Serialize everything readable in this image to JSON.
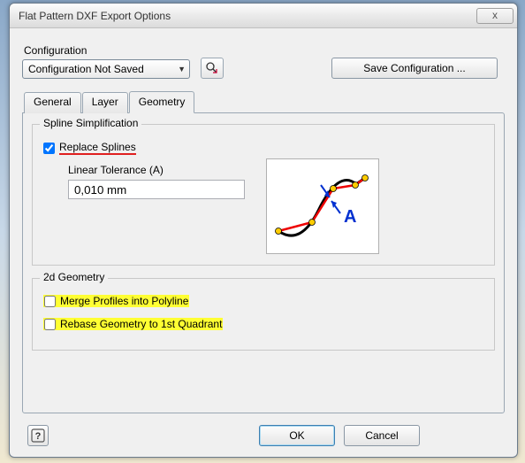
{
  "titlebar": {
    "title": "Flat Pattern DXF Export Options",
    "close_glyph": "x"
  },
  "configuration": {
    "label": "Configuration",
    "selected": "Configuration Not Saved",
    "save_btn": "Save Configuration ..."
  },
  "tabs": {
    "general": "General",
    "layer": "Layer",
    "geometry": "Geometry"
  },
  "spline_group": {
    "legend": "Spline Simplification",
    "replace_checkbox": {
      "label": "Replace Splines",
      "checked": true
    },
    "linear_tolerance_label": "Linear Tolerance (A)",
    "linear_tolerance_value": "0,010 mm"
  },
  "geom2d_group": {
    "legend": "2d Geometry",
    "merge_checkbox": {
      "label": "Merge Profiles into Polyline",
      "checked": false
    },
    "rebase_checkbox": {
      "label": "Rebase Geometry to 1st Quadrant",
      "checked": false
    }
  },
  "buttons": {
    "help_glyph": "?",
    "ok": "OK",
    "cancel": "Cancel"
  },
  "illustration_letter": "A"
}
